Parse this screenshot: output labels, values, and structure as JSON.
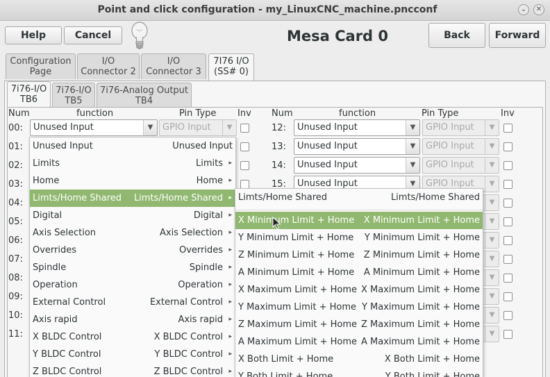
{
  "window": {
    "title": "Point and click configuration - my_LinuxCNC_machine.pncconf",
    "minimize": "⌄",
    "close": "✕"
  },
  "toolbar": {
    "help": "Help",
    "cancel": "Cancel",
    "back": "Back",
    "forward": "Forward",
    "card_title": "Mesa Card 0"
  },
  "main_tabs": [
    {
      "line1": "Configuration",
      "line2": "Page"
    },
    {
      "line1": "I/O",
      "line2": "Connector 2"
    },
    {
      "line1": "I/O",
      "line2": "Connector 3"
    },
    {
      "line1": "7I76 I/O",
      "line2": "(SS# 0)"
    }
  ],
  "sub_tabs": [
    {
      "line1": "7i76-I/O",
      "line2": "TB6"
    },
    {
      "line1": "7i76-I/O",
      "line2": "TB5"
    },
    {
      "line1": "7i76-Analog Output",
      "line2": "TB4"
    }
  ],
  "headers": {
    "num": "Num",
    "function": "function",
    "pin_type": "Pin Type",
    "inv": "Inv"
  },
  "left_rows": [
    "00:",
    "01:",
    "02:",
    "03:",
    "04:",
    "05:",
    "06:",
    "07:",
    "08:",
    "09:",
    "10:",
    "11:"
  ],
  "left_first": {
    "function": "Unused Input",
    "pin_type": "GPIO Input"
  },
  "right_rows": [
    {
      "num": "12:",
      "function": "Unused Input",
      "pin_type": "GPIO Input"
    },
    {
      "num": "13:",
      "function": "Unused Input",
      "pin_type": "GPIO Input"
    },
    {
      "num": "14:",
      "function": "Unused Input",
      "pin_type": "GPIO Input"
    },
    {
      "num": "15:",
      "function": "Unused Input",
      "pin_type": "GPIO Input"
    }
  ],
  "menu_items": [
    {
      "label": "Unused Input",
      "right": "Unused Input",
      "sub": false
    },
    {
      "label": "Limits",
      "right": "Limits",
      "sub": true
    },
    {
      "label": "Home",
      "right": "Home",
      "sub": true
    },
    {
      "label": "Limts/Home Shared",
      "right": "Limts/Home Shared",
      "sub": true
    },
    {
      "label": "Digital",
      "right": "Digital",
      "sub": true
    },
    {
      "label": "Axis Selection",
      "right": "Axis Selection",
      "sub": true
    },
    {
      "label": "Overrides",
      "right": "Overrides",
      "sub": true
    },
    {
      "label": "Spindle",
      "right": "Spindle",
      "sub": true
    },
    {
      "label": "Operation",
      "right": "Operation",
      "sub": true
    },
    {
      "label": "External Control",
      "right": "External Control",
      "sub": true
    },
    {
      "label": "Axis rapid",
      "right": "Axis rapid",
      "sub": true
    },
    {
      "label": "X BLDC Control",
      "right": "X BLDC Control",
      "sub": true
    },
    {
      "label": "Y BLDC Control",
      "right": "Y BLDC Control",
      "sub": true
    },
    {
      "label": "Z BLDC Control",
      "right": "Z BLDC Control",
      "sub": true
    }
  ],
  "submenu_header": {
    "label": "Limts/Home Shared",
    "right": "Limts/Home Shared"
  },
  "submenu_items": [
    {
      "label": "X Minimum Limit + Home",
      "right": "X Minimum Limit + Home"
    },
    {
      "label": "Y Minimum Limit + Home",
      "right": "Y Minimum Limit + Home"
    },
    {
      "label": "Z Minimum Limit + Home",
      "right": "Z Minimum Limit + Home"
    },
    {
      "label": "A Minimum Limit + Home",
      "right": "A Minimum Limit + Home"
    },
    {
      "label": "X Maximum Limit + Home",
      "right": "X Maximum Limit + Home"
    },
    {
      "label": "Y Maximum Limit + Home",
      "right": "Y Maximum Limit + Home"
    },
    {
      "label": "Z Maximum Limit + Home",
      "right": "Z Maximum Limit + Home"
    },
    {
      "label": "A Maximum Limit + Home",
      "right": "A Maximum Limit + Home"
    },
    {
      "label": "X Both Limit + Home",
      "right": "X Both Limit + Home"
    },
    {
      "label": "Y Both Limit + Home",
      "right": "Y Both Limit + Home"
    }
  ],
  "highlight_color": "#90b870"
}
